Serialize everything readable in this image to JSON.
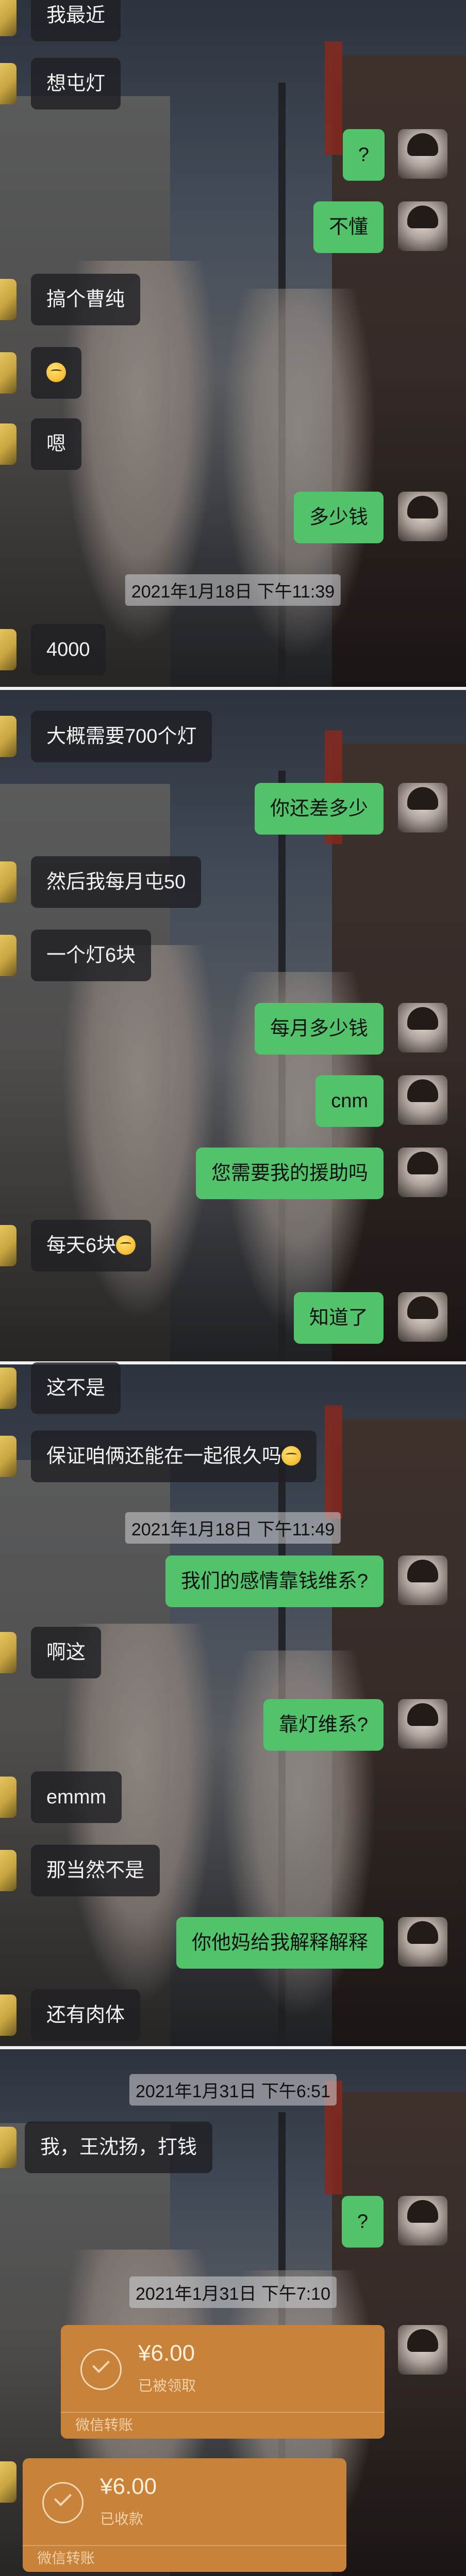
{
  "timestamps": {
    "t1": "2021年1月18日 下午11:39",
    "t2": "2021年1月18日 下午11:49",
    "t3": "2021年1月31日 下午6:51",
    "t4": "2021年1月31日 下午7:10"
  },
  "messages": {
    "m1": "我最近",
    "m2": "想屯灯",
    "m3": "?",
    "m4": "不懂",
    "m5": "搞个曹纯",
    "m7": "嗯",
    "m8": "多少钱",
    "m9": "4000",
    "m10": "大概需要700个灯",
    "m11": "你还差多少",
    "m12": "然后我每月屯50",
    "m13": "一个灯6块",
    "m14": "每月多少钱",
    "m15": "cnm",
    "m16": "您需要我的援助吗",
    "m17": "每天6块",
    "m18": "知道了",
    "m19": "这不是",
    "m20": "保证咱俩还能在一起很久吗",
    "m21": "我们的感情靠钱维系?",
    "m22": "啊这",
    "m23": "靠灯维系?",
    "m24": "emmm",
    "m25": "那当然不是",
    "m26": "你他妈给我解释解释",
    "m27": "还有肉体",
    "m28": "我，王沈扬，打钱",
    "m29": "?"
  },
  "transfers": {
    "sent": {
      "amount": "¥6.00",
      "status": "已被领取",
      "label": "微信转账"
    },
    "received": {
      "amount": "¥6.00",
      "status": "已收款",
      "label": "微信转账"
    }
  }
}
